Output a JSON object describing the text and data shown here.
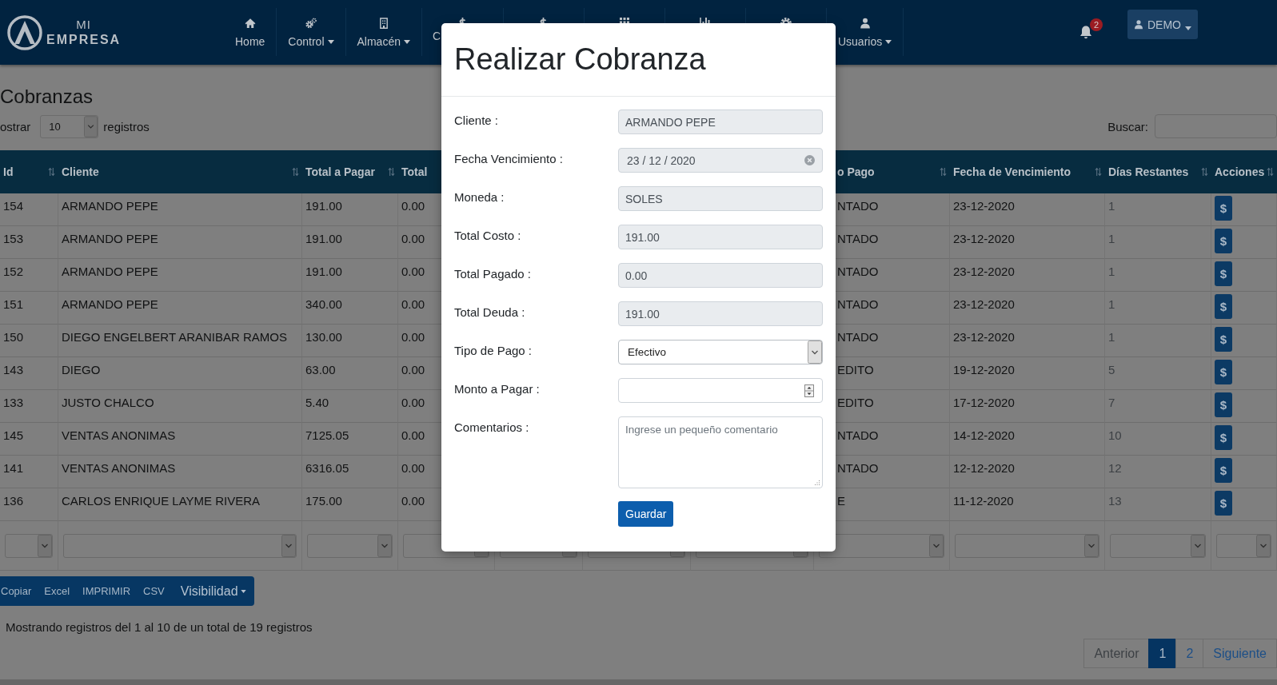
{
  "navbar": {
    "brand": {
      "top": "MI",
      "bottom": "EMPRESA"
    },
    "items": [
      {
        "kind": "full",
        "label": "Home",
        "dropdown": false
      },
      {
        "kind": "full",
        "label": "Control",
        "dropdown": true
      },
      {
        "kind": "full",
        "label": "Almacén",
        "dropdown": true
      },
      {
        "kind": "partial",
        "label": "C"
      },
      {
        "kind": "covered"
      },
      {
        "kind": "covered"
      },
      {
        "kind": "covered"
      },
      {
        "kind": "covered"
      },
      {
        "kind": "full",
        "label": "Usuarios",
        "dropdown": true
      }
    ],
    "notifications": {
      "count": "2"
    },
    "user_menu": {
      "label": "DEMO",
      "dropdown": true
    }
  },
  "page": {
    "title": "Cobranzas",
    "page_length": {
      "label": "ostrar",
      "value": "10",
      "suffix": "registros"
    },
    "search": {
      "label": "Buscar:"
    }
  },
  "table": {
    "columns": [
      {
        "kind": "text",
        "label": "Id"
      },
      {
        "kind": "text",
        "label": "Cliente"
      },
      {
        "kind": "text",
        "label": "Total a Pagar"
      },
      {
        "kind": "partial",
        "label": "Total"
      },
      {
        "kind": "clipped",
        "label": "o Pago"
      },
      {
        "kind": "text",
        "label": "Fecha de Vencimiento"
      },
      {
        "kind": "muted",
        "label": "Días Restantes"
      },
      {
        "kind": "action",
        "label": "Acciones"
      }
    ],
    "rows": [
      {
        "cells": [
          "154",
          "ARMANDO PEPE",
          "191.00",
          "0.00",
          "NTADO",
          "23-12-2020",
          "1",
          "$"
        ]
      },
      {
        "cells": [
          "153",
          "ARMANDO PEPE",
          "191.00",
          "0.00",
          "NTADO",
          "23-12-2020",
          "1",
          "$"
        ]
      },
      {
        "cells": [
          "152",
          "ARMANDO PEPE",
          "191.00",
          "0.00",
          "NTADO",
          "23-12-2020",
          "1",
          "$"
        ]
      },
      {
        "cells": [
          "151",
          "ARMANDO PEPE",
          "340.00",
          "0.00",
          "NTADO",
          "23-12-2020",
          "1",
          "$"
        ]
      },
      {
        "cells": [
          "150",
          "DIEGO ENGELBERT ARANIBAR RAMOS",
          "130.00",
          "0.00",
          "NTADO",
          "23-12-2020",
          "1",
          "$"
        ]
      },
      {
        "cells": [
          "143",
          "DIEGO",
          "63.00",
          "0.00",
          "EDITO",
          "19-12-2020",
          "5",
          "$"
        ]
      },
      {
        "cells": [
          "133",
          "JUSTO CHALCO",
          "5.40",
          "0.00",
          "EDITO",
          "17-12-2020",
          "7",
          "$"
        ]
      },
      {
        "cells": [
          "145",
          "VENTAS ANONIMAS",
          "7125.05",
          "0.00",
          "NTADO",
          "14-12-2020",
          "10",
          "$"
        ]
      },
      {
        "cells": [
          "141",
          "VENTAS ANONIMAS",
          "6316.05",
          "0.00",
          "NTADO",
          "12-12-2020",
          "12",
          "$"
        ]
      },
      {
        "cells": [
          "136",
          "CARLOS ENRIQUE LAYME RIVERA",
          "175.00",
          "0.00",
          "E",
          "11-12-2020",
          "13",
          "$"
        ]
      }
    ]
  },
  "export_buttons": [
    {
      "kind": "plain",
      "label": "Copiar"
    },
    {
      "kind": "plain",
      "label": "Excel"
    },
    {
      "kind": "plain",
      "label": "IMPRIMIR"
    },
    {
      "kind": "plain",
      "label": "CSV"
    },
    {
      "kind": "dropdown",
      "label": "Visibilidad"
    }
  ],
  "info": "Mostrando registros del 1 al 10 de un total de 19 registros",
  "pagination": {
    "previous": {
      "label": "Anterior",
      "disabled": true
    },
    "pages": [
      {
        "label": "1",
        "selected": true
      },
      {
        "label": "2",
        "selected": false
      }
    ],
    "next": {
      "label": "Siguiente",
      "disabled": false
    }
  },
  "modal": {
    "title": "Realizar Cobranza",
    "fields": [
      {
        "kind": "readonly",
        "label": "Cliente :",
        "value": "ARMANDO PEPE"
      },
      {
        "kind": "date",
        "label": "Fecha Vencimiento :",
        "value": "23 / 12 / 2020"
      },
      {
        "kind": "readonly",
        "label": "Moneda :",
        "value": "SOLES"
      },
      {
        "kind": "readonly",
        "label": "Total Costo :",
        "value": "191.00"
      },
      {
        "kind": "readonly",
        "label": "Total Pagado :",
        "value": "0.00"
      },
      {
        "kind": "readonly",
        "label": "Total Deuda :",
        "value": "191.00"
      },
      {
        "kind": "select",
        "label": "Tipo de Pago :",
        "value": "Efectivo"
      },
      {
        "kind": "number",
        "label": "Monto a Pagar :"
      },
      {
        "kind": "textarea",
        "label": "Comentarios :",
        "placeholder": "Ingrese un pequeño comentario"
      }
    ],
    "submit": "Guardar"
  }
}
